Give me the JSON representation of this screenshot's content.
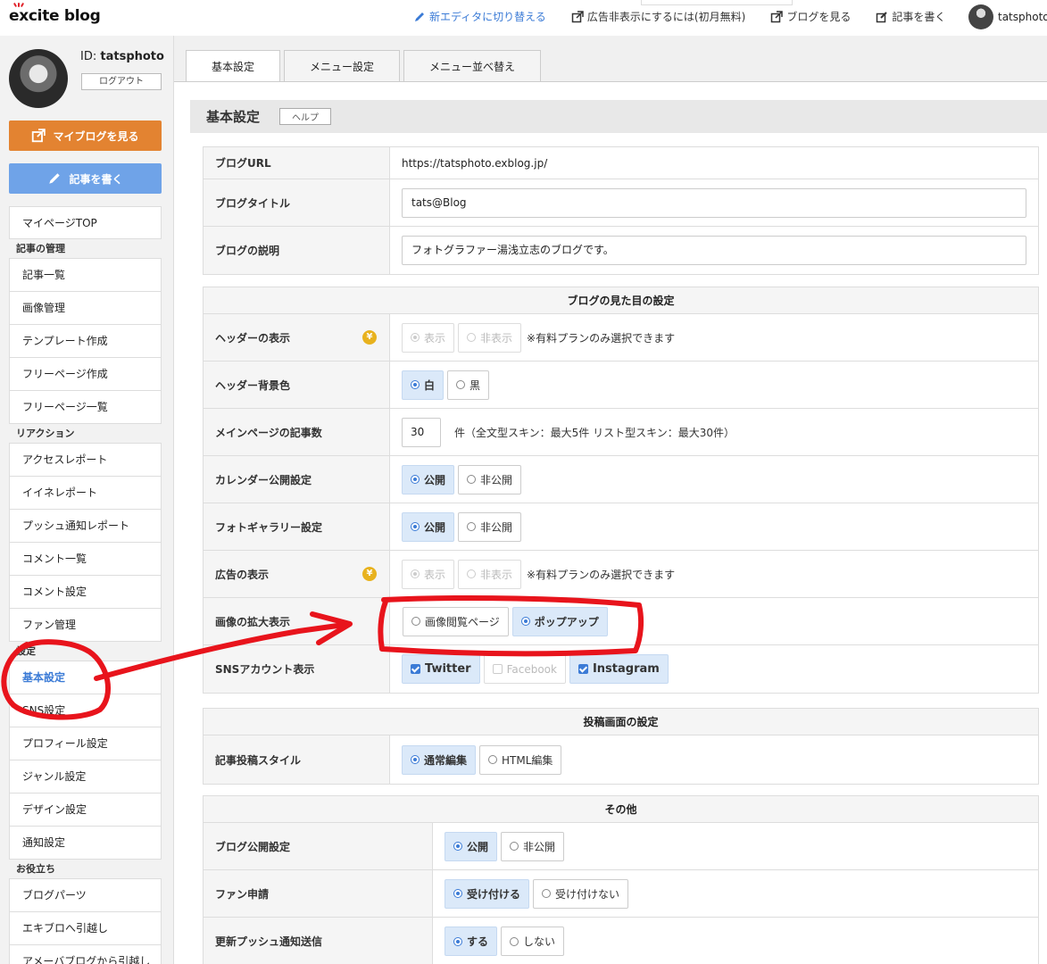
{
  "header": {
    "logo": "excite blog",
    "links": [
      {
        "label": "新エディタに切り替える",
        "icon": "pen-icon"
      },
      {
        "label": "広告非表示にするには(初月無料)",
        "icon": "external-link-icon"
      },
      {
        "label": "ブログを見る",
        "icon": "external-link-icon"
      },
      {
        "label": "記事を書く",
        "icon": "edit-icon"
      }
    ],
    "username": "tatsphoto"
  },
  "sidebar": {
    "id_label": "ID:",
    "id_value": "tatsphoto",
    "logout": "ログアウト",
    "view_blog_btn": "マイブログを見る",
    "write_btn": "記事を書く",
    "top_item": "マイページTOP",
    "groups": [
      {
        "title": "記事の管理",
        "items": [
          "記事一覧",
          "画像管理",
          "テンプレート作成",
          "フリーページ作成",
          "フリーページ一覧"
        ]
      },
      {
        "title": "リアクション",
        "items": [
          "アクセスレポート",
          "イイネレポート",
          "プッシュ通知レポート",
          "コメント一覧",
          "コメント設定",
          "ファン管理"
        ]
      },
      {
        "title": "設定",
        "items": [
          "基本設定",
          "SNS設定",
          "プロフィール設定",
          "ジャンル設定",
          "デザイン設定",
          "通知設定"
        ]
      },
      {
        "title": "お役立ち",
        "items": [
          "ブログパーツ",
          "エキブロへ引越し",
          "アメーバブログから引越し"
        ]
      }
    ]
  },
  "tabs": [
    "基本設定",
    "メニュー設定",
    "メニュー並べ替え"
  ],
  "panel": {
    "title": "基本設定",
    "help": "ヘルプ"
  },
  "basic": {
    "url_label": "ブログURL",
    "url_value": "https://tatsphoto.exblog.jp/",
    "title_label": "ブログタイトル",
    "title_value": "tats@Blog",
    "desc_label": "ブログの説明",
    "desc_value": "フォトグラファー湯浅立志のブログです。"
  },
  "appearance": {
    "heading": "ブログの見た目の設定",
    "header_display": {
      "label": "ヘッダーの表示",
      "options": [
        "表示",
        "非表示"
      ],
      "note": "※有料プランのみ選択できます"
    },
    "header_bg": {
      "label": "ヘッダー背景色",
      "options": [
        "白",
        "黒"
      ]
    },
    "post_count": {
      "label": "メインページの記事数",
      "value": "30",
      "note": "件（全文型スキン：最大5件 リスト型スキン：最大30件）"
    },
    "calendar": {
      "label": "カレンダー公開設定",
      "options": [
        "公開",
        "非公開"
      ]
    },
    "gallery": {
      "label": "フォトギャラリー設定",
      "options": [
        "公開",
        "非公開"
      ]
    },
    "ads": {
      "label": "広告の表示",
      "options": [
        "表示",
        "非表示"
      ],
      "note": "※有料プランのみ選択できます"
    },
    "image_zoom": {
      "label": "画像の拡大表示",
      "options": [
        "画像閲覧ページ",
        "ポップアップ"
      ]
    },
    "sns": {
      "label": "SNSアカウント表示",
      "options": [
        "Twitter",
        "Facebook",
        "Instagram"
      ]
    }
  },
  "posting": {
    "heading": "投稿画面の設定",
    "style": {
      "label": "記事投稿スタイル",
      "options": [
        "通常編集",
        "HTML編集"
      ]
    }
  },
  "other": {
    "heading": "その他",
    "publish": {
      "label": "ブログ公開設定",
      "options": [
        "公開",
        "非公開"
      ]
    },
    "fan": {
      "label": "ファン申請",
      "options": [
        "受け付ける",
        "受け付けない"
      ]
    },
    "push": {
      "label": "更新プッシュ通知送信",
      "options": [
        "する",
        "しない"
      ]
    }
  },
  "colors": {
    "accent": "#3b7bd6",
    "orange": "#e38331",
    "annotation": "#e8141c"
  }
}
